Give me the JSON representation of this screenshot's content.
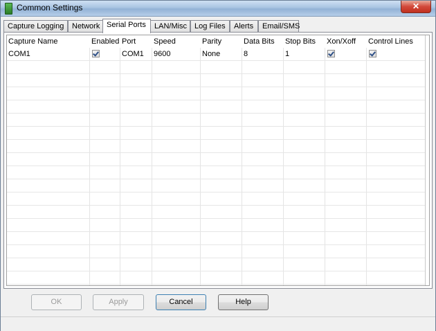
{
  "window": {
    "title": "Common Settings",
    "close_label": "✕"
  },
  "tabs": [
    {
      "label": "Capture Logging",
      "active": false
    },
    {
      "label": "Network",
      "active": false
    },
    {
      "label": "Serial Ports",
      "active": true
    },
    {
      "label": "LAN/Misc",
      "active": false
    },
    {
      "label": "Log Files",
      "active": false
    },
    {
      "label": "Alerts",
      "active": false
    },
    {
      "label": "Email/SMS",
      "active": false
    }
  ],
  "grid": {
    "columns": [
      "Capture Name",
      "Enabled",
      "Port",
      "Speed",
      "Parity",
      "Data Bits",
      "Stop Bits",
      "Xon/Xoff",
      "Control Lines"
    ],
    "rows": [
      {
        "capture_name": "COM1",
        "enabled": true,
        "port": "COM1",
        "speed": "9600",
        "parity": "None",
        "data_bits": "8",
        "stop_bits": "1",
        "xon_xoff": true,
        "control_lines": true
      }
    ]
  },
  "buttons": {
    "ok": "OK",
    "apply": "Apply",
    "cancel": "Cancel",
    "help": "Help"
  }
}
